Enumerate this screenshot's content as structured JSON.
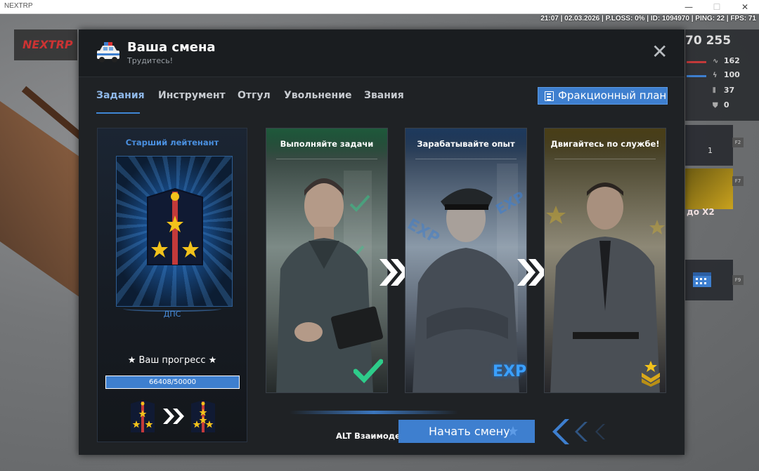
{
  "window": {
    "title": "NEXTRP",
    "minimize": "—",
    "maximize": "☐",
    "close": "✕"
  },
  "status_bar": "21:07 | 02.03.2026 | P.LOSS: 0% | ID: 1094970 | PING: 22 | FPS: 71",
  "hud": {
    "logo": "NEXTRP",
    "money": "70 255",
    "stats": [
      {
        "icon": "heartbeat-icon",
        "value": "162"
      },
      {
        "icon": "lightning-icon",
        "value": "100"
      },
      {
        "icon": "ammo-icon",
        "value": "37"
      },
      {
        "icon": "shield-icon",
        "value": "0"
      }
    ],
    "slots": [
      {
        "key": "F2",
        "value": "1"
      },
      {
        "key": "F7",
        "value": "до X2"
      },
      {
        "key": "F9",
        "value": ""
      }
    ]
  },
  "modal": {
    "title": "Ваша смена",
    "subtitle": "Трудитесь!",
    "tabs": [
      "Задания",
      "Инструмент",
      "Отгул",
      "Увольнение",
      "Звания"
    ],
    "active_tab": 0,
    "plan_button": "Фракционный план"
  },
  "rank": {
    "title": "Старший лейтенант",
    "department": "ДПС",
    "progress_title": "★ Ваш прогресс ★",
    "progress_current": 66408,
    "progress_max": 50000,
    "progress_text": "66408/50000"
  },
  "cards": [
    {
      "title": "Выполняйте задачи",
      "badge": "check-icon"
    },
    {
      "title": "Зарабатывайте опыт",
      "badge": "EXP"
    },
    {
      "title": "Двигайтесь по службе!",
      "badge": "rank-chevron-icon"
    }
  ],
  "footer": {
    "interaction_hint": "ALT Взаимодействие",
    "start_button": "Начать смену"
  },
  "colors": {
    "accent": "#3e7fcf",
    "panel": "#1f2225",
    "rank_blue": "#4a90e0",
    "check_green": "#2ecc8a",
    "gold": "#f2c21b",
    "strap_red": "#c33a3a"
  }
}
